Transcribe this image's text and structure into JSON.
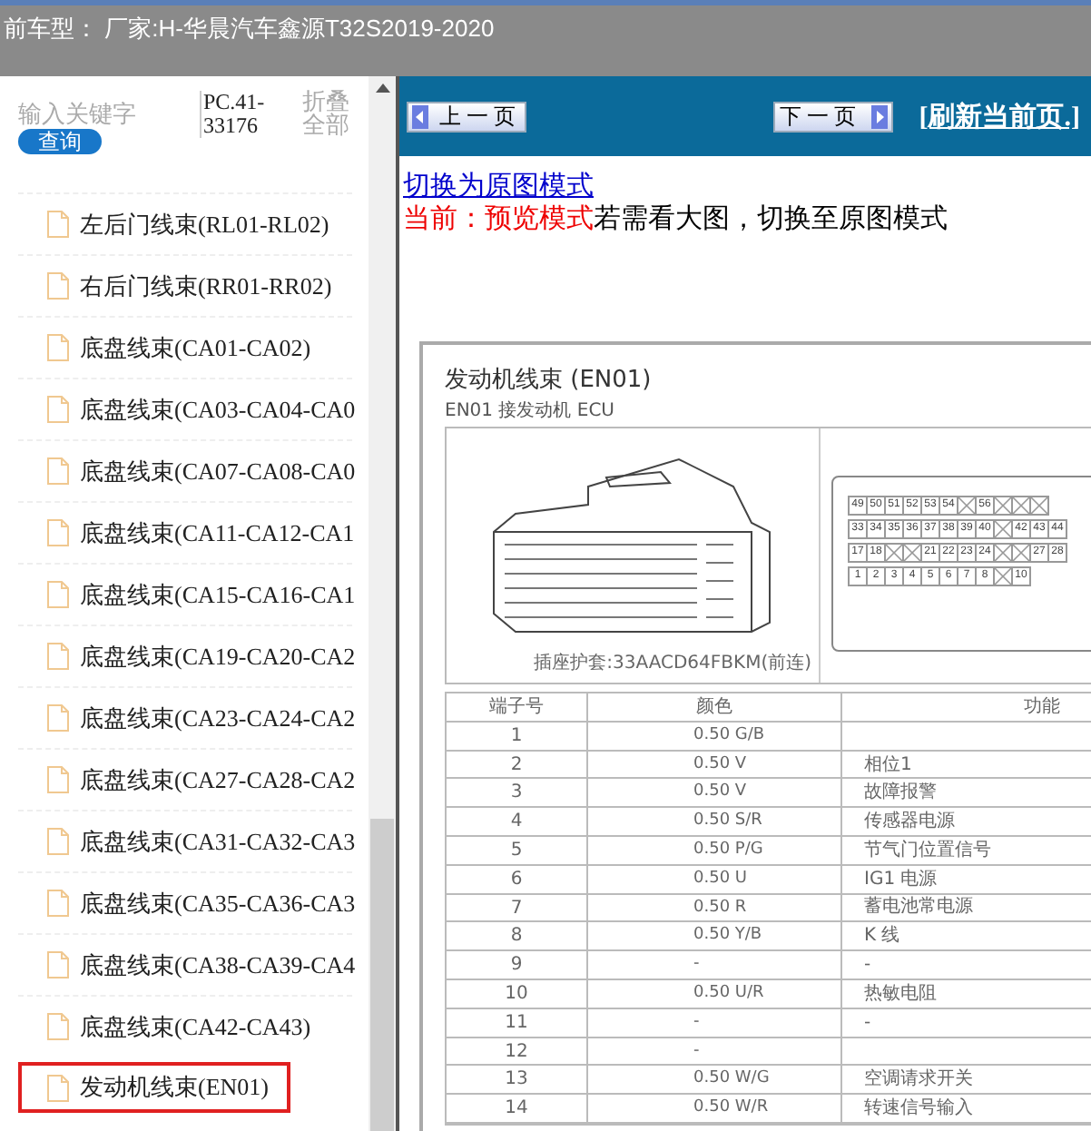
{
  "header": {
    "title": "前车型： 厂家:H-华晨汽车鑫源T32S2019-2020"
  },
  "sidebar": {
    "search": {
      "placeholder": "输入关键字"
    },
    "search_button": "查询",
    "part_code": "PC.41-33176",
    "collapse_all": "折叠全部",
    "items": [
      {
        "label": "左后门线束(RL01-RL02)",
        "selected": false
      },
      {
        "label": "右后门线束(RR01-RR02)",
        "selected": false
      },
      {
        "label": "底盘线束(CA01-CA02)",
        "selected": false
      },
      {
        "label": "底盘线束(CA03-CA04-CA0",
        "selected": false
      },
      {
        "label": "底盘线束(CA07-CA08-CA0",
        "selected": false
      },
      {
        "label": "底盘线束(CA11-CA12-CA1",
        "selected": false
      },
      {
        "label": "底盘线束(CA15-CA16-CA1",
        "selected": false
      },
      {
        "label": "底盘线束(CA19-CA20-CA2",
        "selected": false
      },
      {
        "label": "底盘线束(CA23-CA24-CA2",
        "selected": false
      },
      {
        "label": "底盘线束(CA27-CA28-CA2",
        "selected": false
      },
      {
        "label": "底盘线束(CA31-CA32-CA3",
        "selected": false
      },
      {
        "label": "底盘线束(CA35-CA36-CA3",
        "selected": false
      },
      {
        "label": "底盘线束(CA38-CA39-CA4",
        "selected": false
      },
      {
        "label": "底盘线束(CA42-CA43)",
        "selected": false
      },
      {
        "label": "发动机线束(EN01)",
        "selected": true
      }
    ]
  },
  "toolbar": {
    "prev_button": "上一页",
    "next_button": "下一页",
    "refresh_link": "[刷新当前页.]"
  },
  "mode_link": "切换为原图模式",
  "mode_status": "当前：预览模式",
  "mode_hint": "若需看大图，切换至原图模式",
  "document": {
    "title": "发动机线束 (EN01)",
    "subtitle": "EN01 接发动机 ECU",
    "caption": "插座护套:33AACD64FBKM(前连)",
    "pin_rows": [
      [
        {
          "label": "49"
        },
        {
          "label": "50"
        },
        {
          "label": "51"
        },
        {
          "label": "52"
        },
        {
          "label": "53"
        },
        {
          "label": "54"
        },
        {
          "kind": "crossed"
        },
        {
          "label": "56"
        },
        {
          "kind": "crossed"
        },
        {
          "kind": "crossed"
        },
        {
          "kind": "crossed"
        }
      ],
      [
        {
          "label": "33"
        },
        {
          "label": "34"
        },
        {
          "label": "35"
        },
        {
          "label": "36"
        },
        {
          "label": "37"
        },
        {
          "label": "38"
        },
        {
          "label": "39"
        },
        {
          "label": "40"
        },
        {
          "kind": "crossed"
        },
        {
          "label": "42"
        },
        {
          "label": "43"
        },
        {
          "label": "44"
        }
      ],
      [
        {
          "label": "17"
        },
        {
          "label": "18"
        },
        {
          "kind": "crossed"
        },
        {
          "kind": "crossed"
        },
        {
          "label": "21"
        },
        {
          "label": "22"
        },
        {
          "label": "23"
        },
        {
          "label": "24"
        },
        {
          "kind": "crossed"
        },
        {
          "kind": "crossed"
        },
        {
          "label": "27"
        },
        {
          "label": "28"
        }
      ],
      [
        {
          "label": "1"
        },
        {
          "label": "2"
        },
        {
          "label": "3"
        },
        {
          "label": "4"
        },
        {
          "label": "5"
        },
        {
          "label": "6"
        },
        {
          "label": "7"
        },
        {
          "label": "8"
        },
        {
          "kind": "crossed"
        },
        {
          "label": "10"
        }
      ]
    ],
    "table": {
      "columns": [
        "端子号",
        "颜色",
        "功能"
      ],
      "rows": [
        {
          "terminal": "1",
          "wire": "0.50 G/B"
        },
        {
          "terminal": "2",
          "wire": "0.50 V",
          "function": "相位1"
        },
        {
          "terminal": "3",
          "wire": "0.50 V",
          "function": "故障报警"
        },
        {
          "terminal": "4",
          "wire": "0.50 S/R",
          "function": "传感器电源"
        },
        {
          "terminal": "5",
          "wire": "0.50 P/G",
          "function": "节气门位置信号"
        },
        {
          "terminal": "6",
          "wire": "0.50 U",
          "function": "IG1 电源"
        },
        {
          "terminal": "7",
          "wire": "0.50 R",
          "function": "蓄电池常电源"
        },
        {
          "terminal": "8",
          "wire": "0.50 Y/B",
          "function": "K 线"
        },
        {
          "terminal": "9",
          "wire": "-",
          "function": "-"
        },
        {
          "terminal": "10",
          "wire": "0.50 U/R",
          "function": "热敏电阻"
        },
        {
          "terminal": "11",
          "wire": "-",
          "function": "-"
        },
        {
          "terminal": "12",
          "wire": "-"
        },
        {
          "terminal": "13",
          "wire": "0.50 W/G",
          "function": "空调请求开关"
        },
        {
          "terminal": "14",
          "wire": "0.50 W/R",
          "function": "转速信号输入"
        }
      ]
    }
  }
}
